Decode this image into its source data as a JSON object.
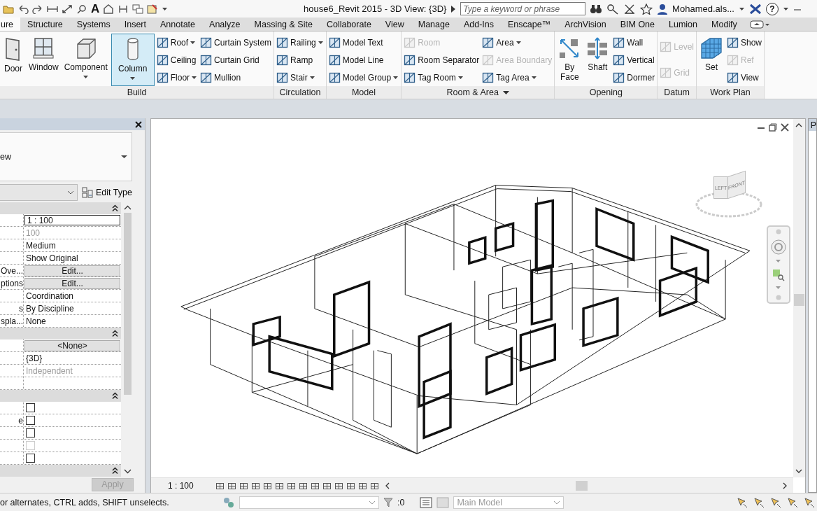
{
  "title_bar": {
    "text_tool_glyph": "A",
    "title": "house6_Revit 2015 - 3D View: {3D}",
    "search": {
      "placeholder": "Type a keyword or phrase"
    },
    "user": "Mohamed.als...",
    "help_glyph": "?"
  },
  "tabs": [
    {
      "label": "ure",
      "selected": true
    },
    {
      "label": "Structure",
      "selected": false
    },
    {
      "label": "Systems",
      "selected": false
    },
    {
      "label": "Insert",
      "selected": false
    },
    {
      "label": "Annotate",
      "selected": false
    },
    {
      "label": "Analyze",
      "selected": false
    },
    {
      "label": "Massing & Site",
      "selected": false
    },
    {
      "label": "Collaborate",
      "selected": false
    },
    {
      "label": "View",
      "selected": false
    },
    {
      "label": "Manage",
      "selected": false
    },
    {
      "label": "Add-Ins",
      "selected": false
    },
    {
      "label": "Enscape™",
      "selected": false
    },
    {
      "label": "ArchVision",
      "selected": false
    },
    {
      "label": "BIM One",
      "selected": false
    },
    {
      "label": "Lumion",
      "selected": false
    },
    {
      "label": "Modify",
      "selected": false
    }
  ],
  "ribbon": {
    "panels": [
      {
        "title": "Build",
        "menu": false,
        "large": [
          {
            "label": "Door",
            "selected": false,
            "dropdown": false
          },
          {
            "label": "Window",
            "selected": false,
            "dropdown": false
          },
          {
            "label": "Component",
            "selected": false,
            "dropdown": true
          },
          {
            "label": "Column",
            "selected": true,
            "dropdown": true
          }
        ],
        "columns": [
          [
            {
              "label": "Roof",
              "disabled": false,
              "dropdown": true
            },
            {
              "label": "Ceiling",
              "disabled": false,
              "dropdown": false
            },
            {
              "label": "Floor",
              "disabled": false,
              "dropdown": true
            }
          ],
          [
            {
              "label": "Curtain System",
              "disabled": false,
              "dropdown": false
            },
            {
              "label": "Curtain Grid",
              "disabled": false,
              "dropdown": false
            },
            {
              "label": "Mullion",
              "disabled": false,
              "dropdown": false
            }
          ]
        ]
      },
      {
        "title": "Circulation",
        "menu": false,
        "columns": [
          [
            {
              "label": "Railing",
              "disabled": false,
              "dropdown": true
            },
            {
              "label": "Ramp",
              "disabled": false,
              "dropdown": false
            },
            {
              "label": "Stair",
              "disabled": false,
              "dropdown": true
            }
          ]
        ]
      },
      {
        "title": "Model",
        "menu": false,
        "columns": [
          [
            {
              "label": "Model Text",
              "disabled": false,
              "dropdown": false
            },
            {
              "label": "Model Line",
              "disabled": false,
              "dropdown": false
            },
            {
              "label": "Model Group",
              "disabled": false,
              "dropdown": true
            }
          ]
        ]
      },
      {
        "title": "Room & Area",
        "menu": true,
        "columns": [
          [
            {
              "label": "Room",
              "disabled": true,
              "dropdown": false
            },
            {
              "label": "Room Separator",
              "disabled": false,
              "dropdown": false
            },
            {
              "label": "Tag Room",
              "disabled": false,
              "dropdown": true
            }
          ],
          [
            {
              "label": "Area",
              "disabled": false,
              "dropdown": true
            },
            {
              "label": "Area Boundary",
              "disabled": true,
              "dropdown": false
            },
            {
              "label": "Tag Area",
              "disabled": false,
              "dropdown": true
            }
          ]
        ]
      },
      {
        "title": "Opening",
        "menu": false,
        "large": [
          {
            "label": "By Face",
            "selected": false,
            "dropdown": false
          },
          {
            "label": "Shaft",
            "selected": false,
            "dropdown": false
          }
        ],
        "columns": [
          [
            {
              "label": "Wall",
              "disabled": false,
              "dropdown": false
            },
            {
              "label": "Vertical",
              "disabled": false,
              "dropdown": false
            },
            {
              "label": "Dormer",
              "disabled": false,
              "dropdown": false
            }
          ]
        ]
      },
      {
        "title": "Datum",
        "menu": false,
        "columns": [
          [
            {
              "label": "Level",
              "disabled": true,
              "dropdown": false
            },
            {
              "label": "Grid",
              "disabled": true,
              "dropdown": false
            }
          ]
        ]
      },
      {
        "title": "Work Plan",
        "menu": false,
        "large": [
          {
            "label": "Set",
            "selected": false,
            "dropdown": false
          }
        ],
        "columns": [
          [
            {
              "label": "Show",
              "disabled": false,
              "dropdown": false
            },
            {
              "label": "Ref",
              "disabled": true,
              "dropdown": false
            },
            {
              "label": "View",
              "disabled": false,
              "dropdown": false
            }
          ]
        ]
      }
    ]
  },
  "properties": {
    "type_name": "ew",
    "edit_type": "Edit Type",
    "groups": [
      {
        "expanded": true,
        "rows": [
          {
            "kind": "field",
            "value": "1 : 100",
            "disabled": false
          },
          {
            "kind": "text",
            "value": "100",
            "disabled": true
          },
          {
            "kind": "text",
            "value": "Medium",
            "disabled": false
          },
          {
            "kind": "text",
            "value": "Show Original",
            "disabled": false
          },
          {
            "kind": "button",
            "name": "Ove...",
            "value": "Edit...",
            "disabled": false
          },
          {
            "kind": "button",
            "name": "ptions",
            "value": "Edit...",
            "disabled": false
          },
          {
            "kind": "text",
            "value": "Coordination",
            "disabled": false
          },
          {
            "kind": "text",
            "name": "s",
            "value": "By Discipline",
            "disabled": false
          },
          {
            "kind": "text",
            "name": "spla...",
            "value": "None",
            "disabled": false
          }
        ]
      },
      {
        "expanded": true,
        "rows": [
          {
            "kind": "button",
            "value": "<None>",
            "disabled": false
          },
          {
            "kind": "text",
            "value": "{3D}",
            "disabled": false
          },
          {
            "kind": "text",
            "value": "Independent",
            "disabled": true
          },
          {
            "kind": "empty"
          }
        ]
      },
      {
        "expanded": true,
        "rows": [
          {
            "kind": "checkbox",
            "checked": false,
            "disabled": false
          },
          {
            "kind": "checkbox",
            "name": "e",
            "checked": false,
            "disabled": false
          },
          {
            "kind": "checkbox",
            "checked": false,
            "disabled": false
          },
          {
            "kind": "checkbox",
            "checked": false,
            "disabled": true
          },
          {
            "kind": "checkbox",
            "checked": false,
            "disabled": false
          }
        ]
      },
      {
        "expanded": true
      }
    ],
    "apply": {
      "label": "Apply",
      "disabled": true
    }
  },
  "view": {
    "view_cube": {
      "left": "LEFT",
      "front": "FRONT"
    },
    "scale": "1 : 100"
  },
  "project_browser_title": "P",
  "status_bar": {
    "hint": "or alternates, CTRL adds, SHIFT unselects.",
    "filter_count": ":0",
    "model": {
      "value": "Main Model",
      "disabled": true
    }
  }
}
